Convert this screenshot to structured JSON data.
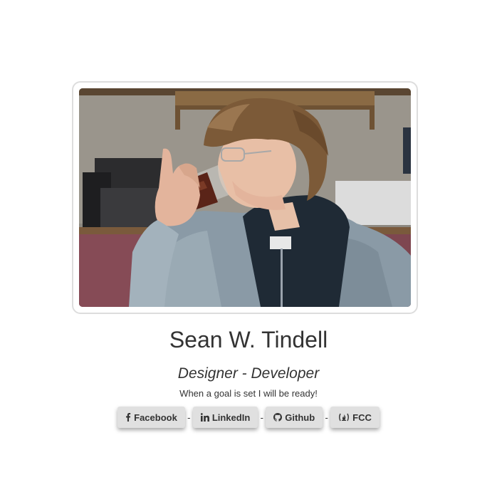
{
  "profile": {
    "photo_alt": "Young man with curly hair and glasses drinking from a glass",
    "name": "Sean W. Tindell",
    "role": "Designer - Developer",
    "motto": "When a goal is set I will be ready!"
  },
  "links": [
    {
      "icon": "facebook-icon",
      "label": "Facebook"
    },
    {
      "icon": "linkedin-icon",
      "label": "LinkedIn"
    },
    {
      "icon": "github-icon",
      "label": "Github"
    },
    {
      "icon": "freecodecamp-icon",
      "label": "FCC"
    }
  ],
  "separator": "-",
  "colors": {
    "button_bg": "#e0e0e0",
    "text": "#333333",
    "frame_border": "#dddddd"
  }
}
